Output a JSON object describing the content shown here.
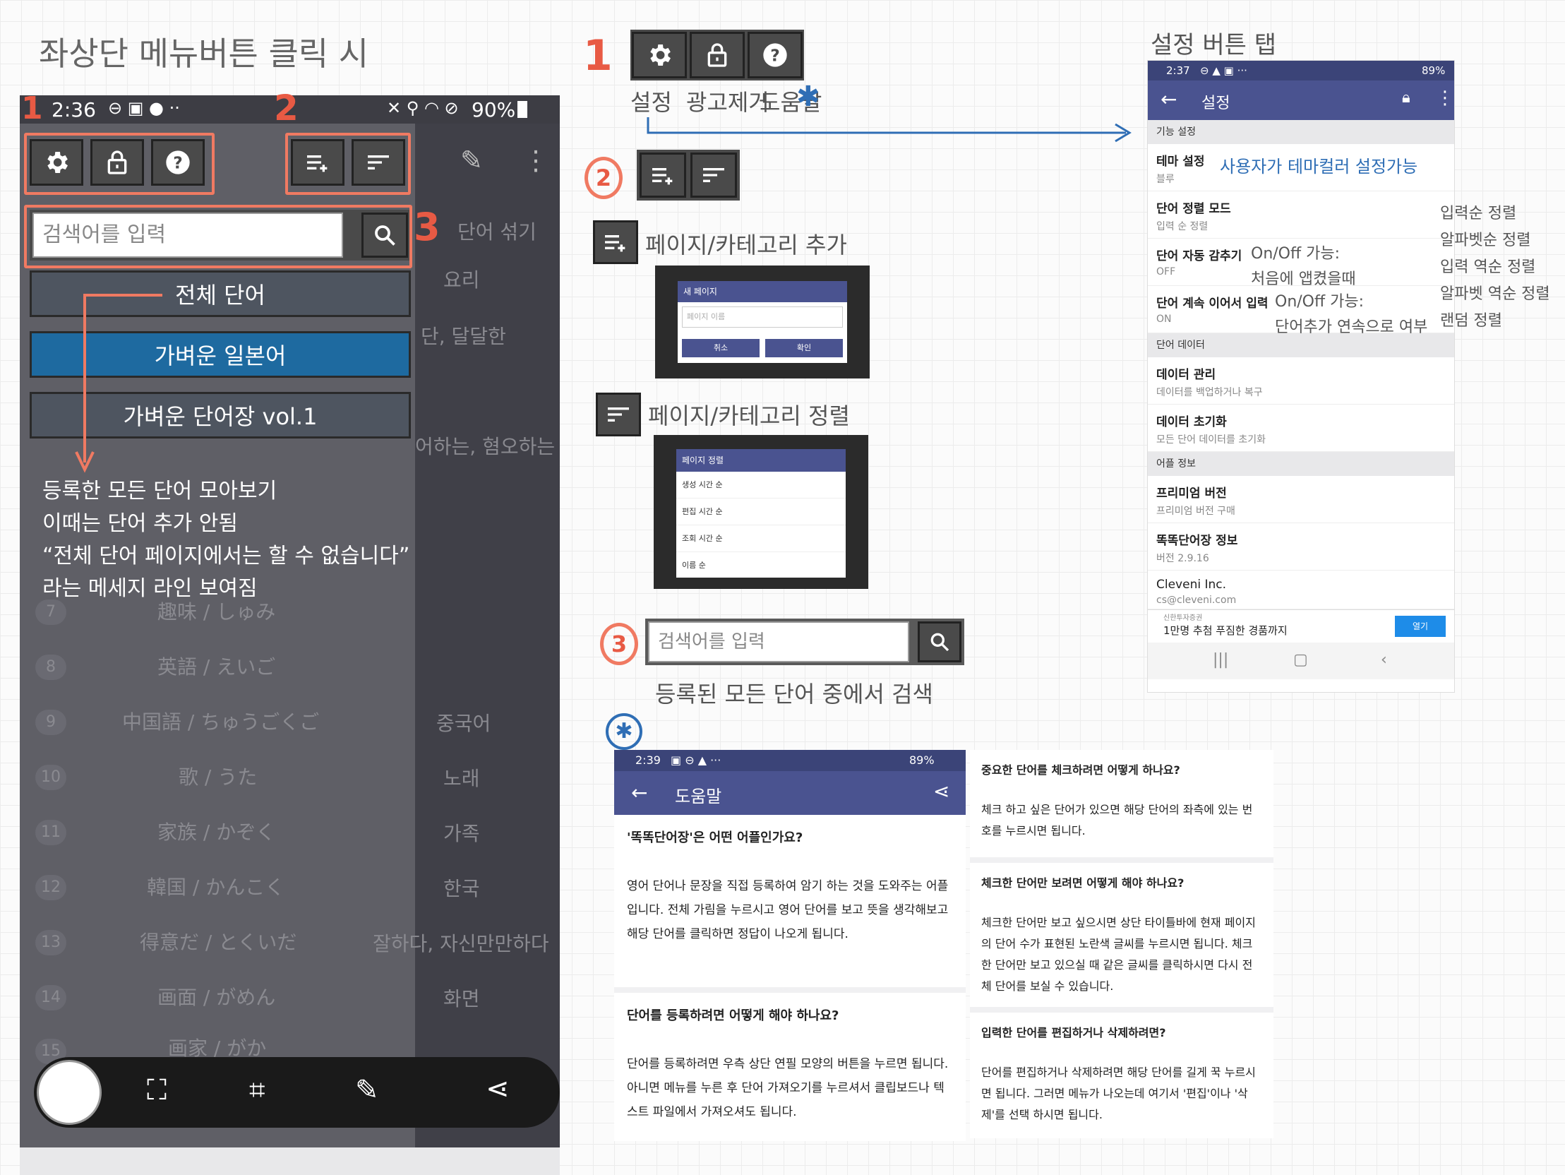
{
  "left_title": "좌상단 메뉴버튼 클릭 시",
  "phone1": {
    "status_time": "2:36",
    "battery": "90%",
    "search_placeholder": "검색어를 입력",
    "menu_items": [
      "전체 단어",
      "가벼운 일본어",
      "가벼운 단어장 vol.1"
    ],
    "right_labels": [
      "단어 섞기",
      "요리",
      "단, 달달한",
      "어하는, 혐오하는",
      "중국어",
      "노래",
      "가족",
      "한국",
      "잘하다, 자신만만하다",
      "화면"
    ],
    "ghost_words": [
      "趣味 / しゅみ",
      "英語 / えいご",
      "中国語 / ちゅうごくご",
      "歌 / うた",
      "家族 / かぞく",
      "韓国 / かんこく",
      "得意だ / とくいだ",
      "画面 / がめん",
      "画家 / がか"
    ],
    "ghost_numbers": [
      "7",
      "8",
      "9",
      "10",
      "11",
      "12",
      "13",
      "14",
      "15"
    ],
    "annotation_lines": [
      "등록한 모든 단어 모아보기",
      "이때는 단어 추가 안됨",
      "“전체 단어 페이지에서는 할 수 없습니다”",
      "라는 메세지 라인 보여짐"
    ]
  },
  "markers": {
    "one": "1",
    "two": "2",
    "three": "3"
  },
  "legend1": {
    "labels": [
      "설정",
      "광고제거",
      "도움말"
    ],
    "star": "✱"
  },
  "add_page": {
    "label": "페이지/카테고리 추가",
    "dialog_title": "새 페이지",
    "input_placeholder": "페이지 이름",
    "cancel": "취소",
    "ok": "확인"
  },
  "sort_page": {
    "label": "페이지/카테고리 정렬",
    "dialog_title": "페이지 정렬",
    "options": [
      "생성 시간 순",
      "편집 시간 순",
      "조회 시간 순",
      "이름 순"
    ]
  },
  "search_legend": {
    "placeholder": "검색어를 입력",
    "caption": "등록된 모든 단어 중에서 검색"
  },
  "settings": {
    "caption": "설정 버튼 탭",
    "status_time": "2:37",
    "battery": "89%",
    "title": "설정",
    "sections": {
      "func": "기능 설정",
      "data": "단어 데이터",
      "info": "어플 정보"
    },
    "items": [
      {
        "title": "테마 설정",
        "sub": "블루"
      },
      {
        "title": "단어 정렬 모드",
        "sub": "입력 순 정렬"
      },
      {
        "title": "단어 자동 감추기",
        "sub": "OFF"
      },
      {
        "title": "단어 계속 이어서 입력",
        "sub": "ON"
      },
      {
        "title": "데이터 관리",
        "sub": "데이터를 백업하거나 복구"
      },
      {
        "title": "데이터 초기화",
        "sub": "모든 단어 데이터를 초기화"
      },
      {
        "title": "프리미엄 버전",
        "sub": "프리미엄 버전 구매"
      },
      {
        "title": "똑똑단어장 정보",
        "sub": "버전 2.9.16"
      },
      {
        "title": "Cleveni Inc.",
        "sub": "cs@cleveni.com"
      }
    ],
    "ad_small": "신한투자증권",
    "ad_text": "1만명 추첨 푸짐한 경품까지",
    "ad_button": "열기",
    "theme_note": "사용자가 테마컬러 설정가능",
    "auto_hide_note": [
      "On/Off 가능:",
      "처음에 앱켰을때"
    ],
    "continue_note": [
      "On/Off 가능:",
      "단어추가 연속으로 여부"
    ],
    "sort_options": [
      "입력순 정렬",
      "알파벳순 정렬",
      "입력 역순 정렬",
      "알파벳 역순 정렬",
      "랜덤 정렬"
    ]
  },
  "help": {
    "status_time": "2:39",
    "battery": "89%",
    "title": "도움말",
    "qa_left": [
      {
        "q": "'똑똑단어장'은 어떤 어플인가요?",
        "a": "영어 단어나 문장을 직접 등록하여 암기 하는 것을 도와주는 어플입니다. 전체 가림을 누르시고 영어 단어를 보고 뜻을 생각해보고 해당 단어를 클릭하면 정답이 나오게 됩니다."
      },
      {
        "q": "단어를 등록하려면 어떻게 해야 하나요?",
        "a": "단어를 등록하려면 우측 상단 연필 모양의 버튼을 누르면 됩니다. 아니면 메뉴를 누른 후 단어 가져오기를 누르셔서 클립보드나 텍스트 파일에서 가져오셔도 됩니다."
      }
    ],
    "qa_right": [
      {
        "q": "중요한 단어를 체크하려면 어떻게 하나요?",
        "a": "체크 하고 싶은 단어가 있으면 해당 단어의 좌측에 있는 번호를 누르시면 됩니다."
      },
      {
        "q": "체크한 단어만 보려면 어떻게 해야 하나요?",
        "a": "체크한 단어만 보고 싶으시면 상단 타이틀바에 현재 페이지의 단어 수가 표현된 노란색 글씨를 누르시면 됩니다. 체크한 단어만 보고 있으실 때 같은 글씨를 클릭하시면 다시 전체 단어를 보실 수 있습니다."
      },
      {
        "q": "입력한 단어를 편집하거나 삭제하려면?",
        "a": "단어를 편집하거나 삭제하려면 해당 단어를 길게 꾹 누르시면 됩니다. 그러면 메뉴가 나오는데 여기서 '편집'이나 '삭제'를 선택 하시면 됩니다."
      }
    ]
  },
  "colors": {
    "accent_red": "#f07a62",
    "app_bar": "#4a5390",
    "blue_button": "#1e6aa0"
  }
}
